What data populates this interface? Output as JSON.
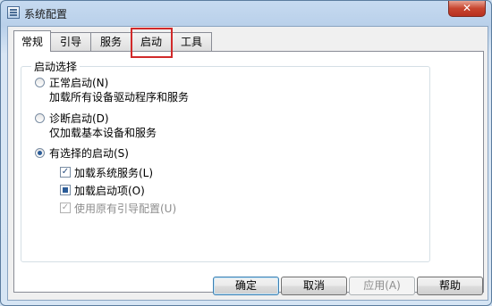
{
  "window": {
    "title": "系统配置",
    "close_label": "✕"
  },
  "tabs": [
    {
      "label": "常规",
      "active": true
    },
    {
      "label": "引导",
      "active": false
    },
    {
      "label": "服务",
      "active": false
    },
    {
      "label": "启动",
      "active": false,
      "highlighted": true
    },
    {
      "label": "工具",
      "active": false
    }
  ],
  "group": {
    "legend": "启动选择",
    "options": [
      {
        "label": "正常启动(N)",
        "description": "加载所有设备驱动程序和服务",
        "selected": false
      },
      {
        "label": "诊断启动(D)",
        "description": "仅加载基本设备和服务",
        "selected": false
      },
      {
        "label": "有选择的启动(S)",
        "selected": true
      }
    ],
    "checkboxes": [
      {
        "label": "加载系统服务(L)",
        "state": "checked"
      },
      {
        "label": "加载启动项(O)",
        "state": "indeterminate"
      },
      {
        "label": "使用原有引导配置(U)",
        "state": "checked-disabled"
      }
    ]
  },
  "buttons": {
    "ok": "确定",
    "cancel": "取消",
    "apply": "应用(A)",
    "help": "帮助"
  },
  "colors": {
    "highlight": "#d12a2a",
    "title_bar": "#c6daf0"
  }
}
